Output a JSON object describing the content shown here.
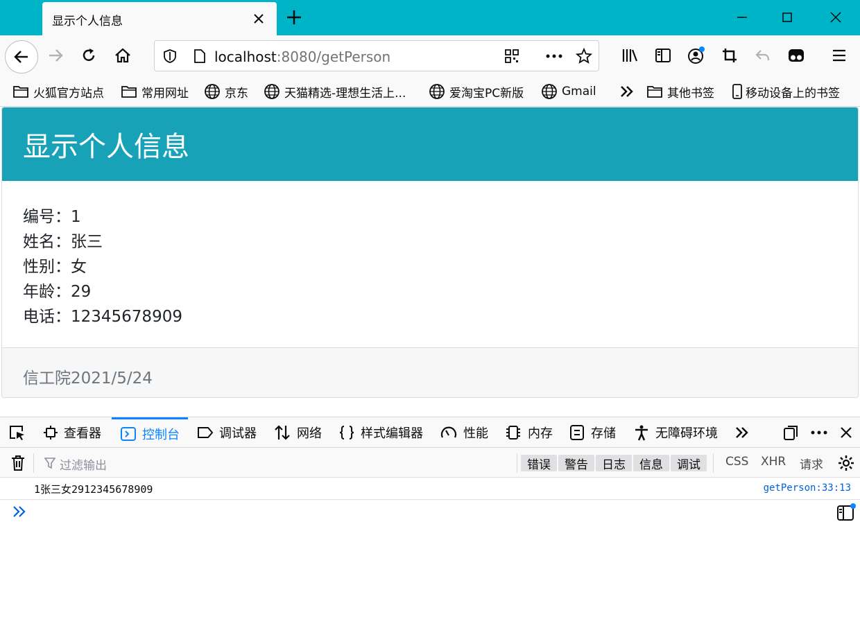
{
  "browser": {
    "tab_title": "显示个人信息",
    "url_host": "localhost",
    "url_rest": ":8080/getPerson",
    "bookmarks": [
      {
        "label": "火狐官方站点",
        "icon": "folder-icon"
      },
      {
        "label": "常用网址",
        "icon": "folder-icon"
      },
      {
        "label": "京东",
        "icon": "globe-icon"
      },
      {
        "label": "天猫精选-理想生活上...",
        "icon": "globe-icon"
      },
      {
        "label": "爱淘宝PC新版",
        "icon": "globe-icon"
      },
      {
        "label": "Gmail",
        "icon": "globe-icon"
      },
      {
        "label": "其他书签",
        "icon": "folder-icon"
      },
      {
        "label": "移动设备上的书签",
        "icon": "mobile-icon"
      }
    ]
  },
  "page": {
    "title": "显示个人信息",
    "fields": [
      {
        "label": "编号：",
        "value": "1"
      },
      {
        "label": "姓名：",
        "value": "张三"
      },
      {
        "label": "性别：",
        "value": "女"
      },
      {
        "label": "年龄：",
        "value": "29"
      },
      {
        "label": "电话：",
        "value": "12345678909"
      }
    ],
    "footer": "信工院2021/5/24"
  },
  "devtools": {
    "tabs": [
      "查看器",
      "控制台",
      "调试器",
      "网络",
      "样式编辑器",
      "性能",
      "内存",
      "存储",
      "无障碍环境"
    ],
    "active_tab": "控制台",
    "filter_placeholder": "过滤输出",
    "levels": [
      "错误",
      "警告",
      "日志",
      "信息",
      "调试"
    ],
    "request_filters": [
      "CSS",
      "XHR",
      "请求"
    ],
    "log": {
      "message": "1张三女2912345678909",
      "source": "getPerson:33:13"
    }
  },
  "colors": {
    "chrome_accent": "#00b4c8",
    "header_bg": "#17a2b8",
    "active_tab": "#0a84ff"
  }
}
